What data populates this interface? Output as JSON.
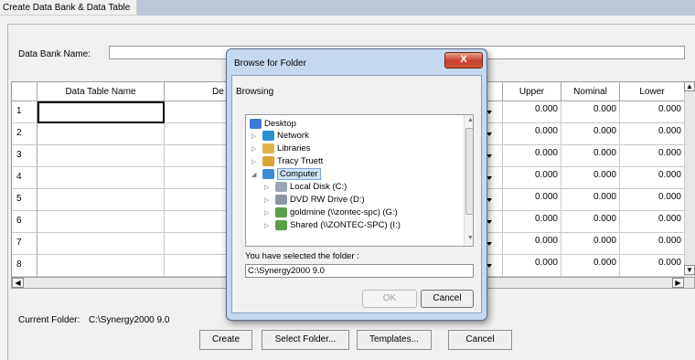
{
  "window": {
    "title": "Create Data Bank & Data Table"
  },
  "bank": {
    "label": "Data Bank Name:",
    "value": ""
  },
  "table": {
    "headers": {
      "row": "",
      "name": "Data Table Name",
      "desc": "De",
      "upper": "Upper",
      "nominal": "Nominal",
      "lower": "Lower"
    },
    "rows": [
      {
        "n": "1",
        "upper": "0.000",
        "nominal": "0.000",
        "lower": "0.000"
      },
      {
        "n": "2",
        "upper": "0.000",
        "nominal": "0.000",
        "lower": "0.000"
      },
      {
        "n": "3",
        "upper": "0.000",
        "nominal": "0.000",
        "lower": "0.000"
      },
      {
        "n": "4",
        "upper": "0.000",
        "nominal": "0.000",
        "lower": "0.000"
      },
      {
        "n": "5",
        "upper": "0.000",
        "nominal": "0.000",
        "lower": "0.000"
      },
      {
        "n": "6",
        "upper": "0.000",
        "nominal": "0.000",
        "lower": "0.000"
      },
      {
        "n": "7",
        "upper": "0.000",
        "nominal": "0.000",
        "lower": "0.000"
      },
      {
        "n": "8",
        "upper": "0.000",
        "nominal": "0.000",
        "lower": "0.000"
      }
    ]
  },
  "current_folder": {
    "label": "Current Folder:",
    "value": "C:\\Synergy2000 9.0"
  },
  "buttons": {
    "create": "Create",
    "select_folder": "Select Folder...",
    "templates": "Templates...",
    "cancel": "Cancel"
  },
  "dialog": {
    "title": "Browse for Folder",
    "close": "X",
    "browsing": "Browsing",
    "tree": [
      {
        "label": "Desktop",
        "icon": "desktop-icon"
      },
      {
        "label": "Network",
        "icon": "network-icon"
      },
      {
        "label": "Libraries",
        "icon": "libraries-icon"
      },
      {
        "label": "Tracy Truett",
        "icon": "user-folder-icon"
      },
      {
        "label": "Computer",
        "icon": "computer-icon"
      },
      {
        "label": "Local Disk (C:)",
        "icon": "local-disk-icon"
      },
      {
        "label": "DVD RW Drive (D:)",
        "icon": "dvd-drive-icon"
      },
      {
        "label": "goldmine (\\\\zontec-spc) (G:)",
        "icon": "network-drive-icon"
      },
      {
        "label": "Shared (\\\\ZONTEC-SPC) (I:)",
        "icon": "network-drive-icon"
      }
    ],
    "selected_label": "You have selected the folder :",
    "selected_value": "C:\\Synergy2000 9.0",
    "ok": "OK",
    "cancel": "Cancel"
  },
  "colors": {
    "title_strip": "#bcc8d8",
    "dialog_frame": "#c6d8ee",
    "close_button": "#c6402a",
    "selection": "#cce4f7"
  }
}
